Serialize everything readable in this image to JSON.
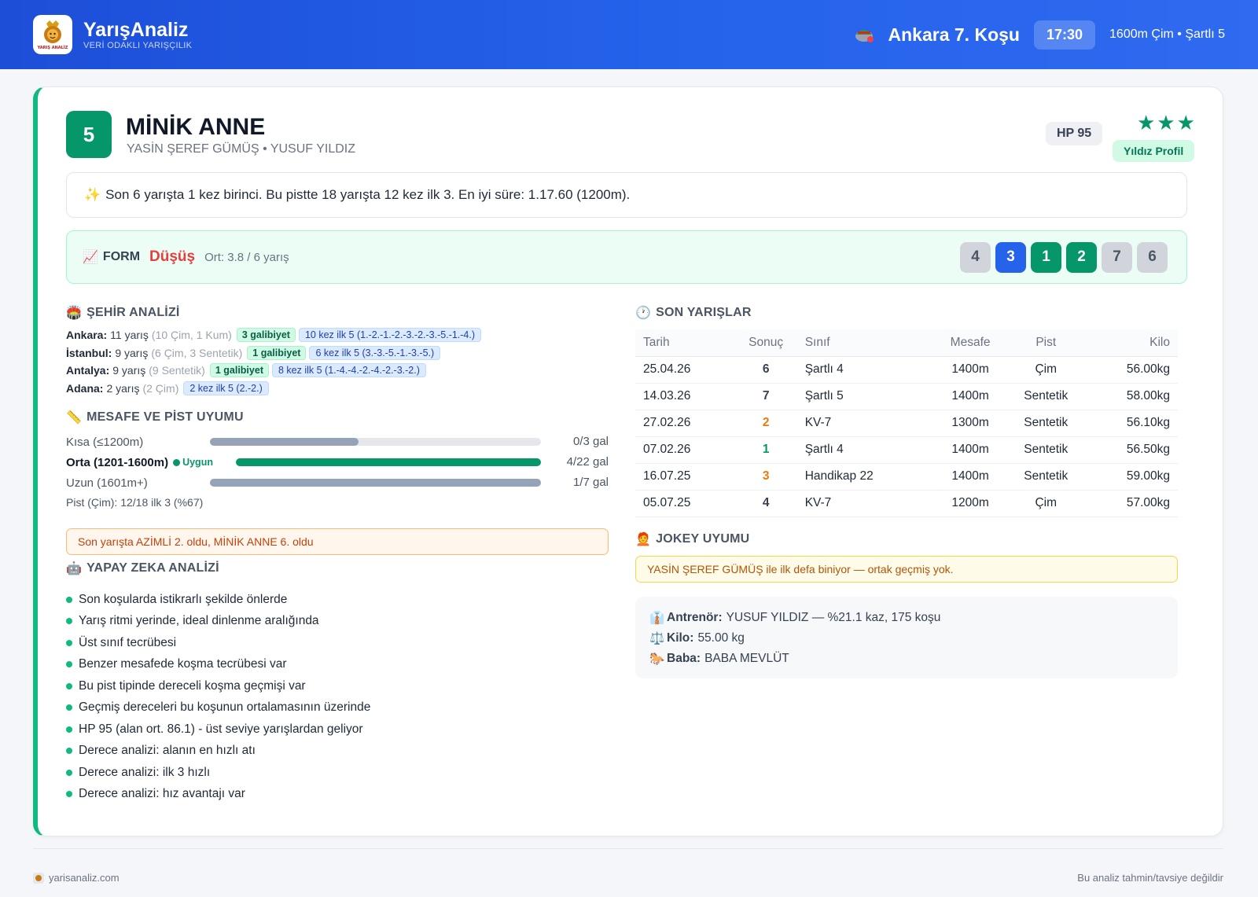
{
  "header": {
    "brand_name": "YarışAnaliz",
    "brand_tagline": "VERİ ODAKLI YARIŞÇILIK",
    "logo_text": "YARIŞ ANALİZ",
    "race_title": "Ankara 7. Koşu",
    "race_time": "17:30",
    "race_meta": "1600m Çim • Şartlı 5"
  },
  "horse": {
    "number": "5",
    "name": "MİNİK ANNE",
    "subtitle": "YASİN ŞEREF GÜMÜŞ • YUSUF YILDIZ",
    "hp": "HP 95",
    "stars": "★★★",
    "profile_badge": "Yıldız Profil"
  },
  "summary": {
    "icon": "✨",
    "text": "Son 6 yarışta 1 kez birinci. Bu pistte 18 yarışta 12 kez ilk 3. En iyi süre: 1.17.60 (1200m)."
  },
  "form": {
    "icon": "📈",
    "label": "FORM",
    "trend": "Düşüş",
    "average": "Ort: 3.8 / 6 yarış",
    "results": [
      {
        "value": "4",
        "style": "grey"
      },
      {
        "value": "3",
        "style": "blue"
      },
      {
        "value": "1",
        "style": "green"
      },
      {
        "value": "2",
        "style": "green"
      },
      {
        "value": "7",
        "style": "grey"
      },
      {
        "value": "6",
        "style": "grey"
      }
    ]
  },
  "city_analysis": {
    "icon": "🏟️",
    "title": "ŞEHİR ANALİZİ",
    "rows": [
      {
        "city": "Ankara:",
        "count": "11 yarış",
        "detail": "(10 Çim, 1 Kum)",
        "wins": "3 galibiyet",
        "top5": "10 kez ilk 5 (1.-2.-1.-2.-3.-2.-3.-5.-1.-4.)"
      },
      {
        "city": "İstanbul:",
        "count": "9 yarış",
        "detail": "(6 Çim, 3 Sentetik)",
        "wins": "1 galibiyet",
        "top5": "6 kez ilk 5 (3.-3.-5.-1.-3.-5.)"
      },
      {
        "city": "Antalya:",
        "count": "9 yarış",
        "detail": "(9 Sentetik)",
        "wins": "1 galibiyet",
        "top5": "8 kez ilk 5 (1.-4.-4.-2.-4.-2.-3.-2.)"
      },
      {
        "city": "Adana:",
        "count": "2 yarış",
        "detail": "(2 Çim)",
        "wins": "",
        "top5": "2 kez ilk 5 (2.-2.)"
      }
    ]
  },
  "distance": {
    "icon": "📏",
    "title": "MESAFE VE PİST UYUMU",
    "rows": [
      {
        "label": "Kısa (≤1200m)",
        "fit": "",
        "value": "0/3 gal",
        "fill": 0.45,
        "color": "#94a3b8"
      },
      {
        "label": "Orta (1201-1600m)",
        "fit": "Uygun",
        "value": "4/22 gal",
        "fill": 1.0,
        "color": "#059669"
      },
      {
        "label": "Uzun (1601m+)",
        "fit": "",
        "value": "1/7 gal",
        "fill": 1.0,
        "color": "#94a3b8"
      }
    ],
    "pist": "Pist (Çim): 12/18 ilk 3 (%67)"
  },
  "last_race_note": "Son yarışta AZİMLİ 2. oldu, MİNİK ANNE 6. oldu",
  "ai": {
    "icon": "🤖",
    "title": "YAPAY ZEKA ANALİZİ",
    "items": [
      "Son koşularda istikrarlı şekilde önlerde",
      "Yarış ritmi yerinde, ideal dinlenme aralığında",
      "Üst sınıf tecrübesi",
      "Benzer mesafede koşma tecrübesi var",
      "Bu pist tipinde dereceli koşma geçmişi var",
      "Geçmiş dereceleri bu koşunun ortalamasının üzerinde",
      "HP 95 (alan ort. 86.1) - üst seviye yarışlardan geliyor",
      "Derece analizi: alanın en hızlı atı",
      "Derece analizi: ilk 3 hızlı",
      "Derece analizi: hız avantajı var"
    ]
  },
  "recent_races": {
    "icon": "🕐",
    "title": "SON YARIŞLAR",
    "columns": [
      "Tarih",
      "Sonuç",
      "Sınıf",
      "Mesafe",
      "Pist",
      "Kilo"
    ],
    "rows": [
      {
        "date": "25.04.26",
        "result": "6",
        "color": "#374151",
        "class": "Şartlı 4",
        "distance": "1400m",
        "track": "Çim",
        "weight": "56.00kg"
      },
      {
        "date": "14.03.26",
        "result": "7",
        "color": "#374151",
        "class": "Şartlı 5",
        "distance": "1400m",
        "track": "Sentetik",
        "weight": "58.00kg"
      },
      {
        "date": "27.02.26",
        "result": "2",
        "color": "#ea7a0c",
        "class": "KV-7",
        "distance": "1300m",
        "track": "Sentetik",
        "weight": "56.10kg"
      },
      {
        "date": "07.02.26",
        "result": "1",
        "color": "#059669",
        "class": "Şartlı 4",
        "distance": "1400m",
        "track": "Sentetik",
        "weight": "56.50kg"
      },
      {
        "date": "16.07.25",
        "result": "3",
        "color": "#ea7a0c",
        "class": "Handikap 22",
        "distance": "1400m",
        "track": "Sentetik",
        "weight": "59.00kg"
      },
      {
        "date": "05.07.25",
        "result": "4",
        "color": "#374151",
        "class": "KV-7",
        "distance": "1200m",
        "track": "Çim",
        "weight": "57.00kg"
      }
    ]
  },
  "jockey": {
    "icon": "🧑‍🦰",
    "title": "JOKEY UYUMU",
    "note": "YASİN ŞEREF GÜMÜŞ ile ilk defa biniyor — ortak geçmiş yok."
  },
  "details": {
    "trainer": {
      "icon": "👔",
      "label": "Antrenör:",
      "value": "YUSUF YILDIZ — %21.1 kaz, 175 koşu"
    },
    "weight": {
      "icon": "⚖️",
      "label": "Kilo:",
      "value": "55.00 kg"
    },
    "sire": {
      "icon": "🐎",
      "label": "Baba:",
      "value": "BABA MEVLÜT"
    }
  },
  "footer": {
    "site": "yarisanaliz.com",
    "disclaimer": "Bu analiz tahmin/tavsiye değildir"
  }
}
